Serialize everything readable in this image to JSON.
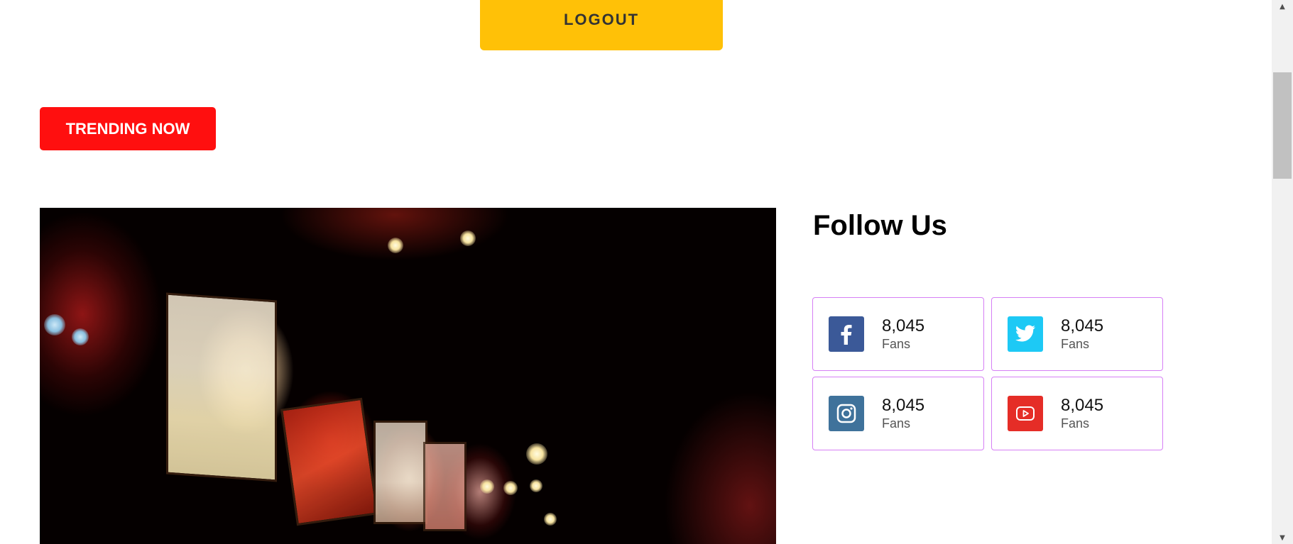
{
  "header": {
    "logout_label": "LOGOUT"
  },
  "trending": {
    "label": "TRENDING NOW"
  },
  "hero": {
    "image_icon": "lanterns-photo"
  },
  "follow": {
    "title": "Follow Us",
    "cards": [
      {
        "network": "facebook",
        "icon": "facebook-icon",
        "color": "#3b5998",
        "count": "8,045",
        "label": "Fans"
      },
      {
        "network": "twitter",
        "icon": "twitter-icon",
        "color": "#1dc9f5",
        "count": "8,045",
        "label": "Fans"
      },
      {
        "network": "instagram",
        "icon": "instagram-icon",
        "color": "#3f729b",
        "count": "8,045",
        "label": "Fans"
      },
      {
        "network": "youtube",
        "icon": "youtube-icon",
        "color": "#e52d27",
        "count": "8,045",
        "label": "Fans"
      }
    ]
  },
  "colors": {
    "logout_bg": "#ffc107",
    "trending_bg": "#ff0f0f",
    "card_border": "#d67ff5"
  }
}
